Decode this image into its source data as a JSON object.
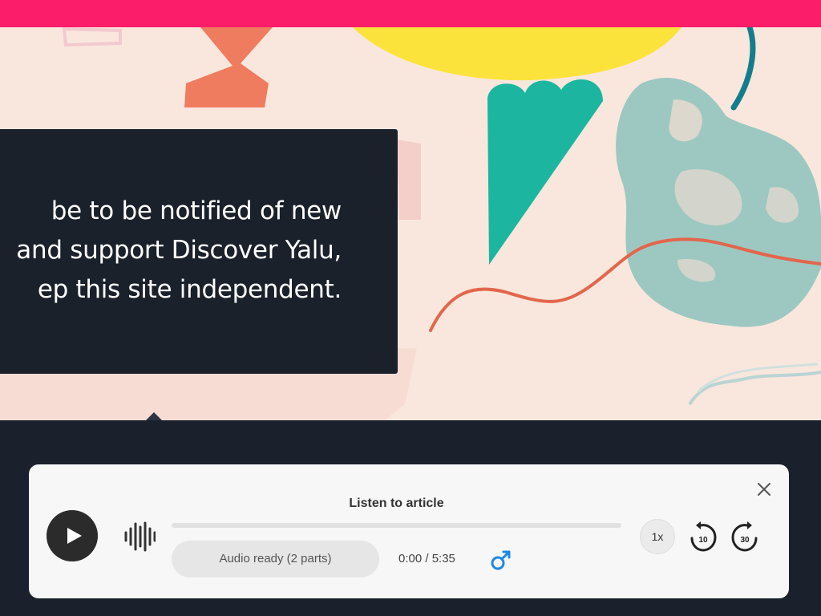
{
  "hero": {
    "promo_text": "be to be notified of new\nand support Discover Yalu,\nep this site independent."
  },
  "player": {
    "title": "Listen to article",
    "status": "Audio ready (2 parts)",
    "time": "0:00 / 5:35",
    "speed": "1x",
    "progress_fraction": 0,
    "skip_back_seconds": "10",
    "skip_forward_seconds": "30",
    "icons": {
      "close": "close-icon",
      "play": "play-icon",
      "waveform": "waveform-icon",
      "voice": "male-voice-icon",
      "skip_back": "rewind-10-icon",
      "skip_forward": "forward-30-icon"
    }
  },
  "colors": {
    "top_bar": "#fb1d6a",
    "dark": "#1a212c",
    "player_bg": "#f7f7f7",
    "voice_icon": "#1e88e5"
  }
}
